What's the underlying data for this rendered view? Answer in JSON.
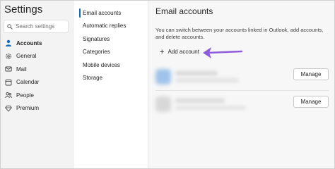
{
  "sidebar": {
    "title": "Settings",
    "search_placeholder": "Search settings",
    "items": [
      {
        "label": "Accounts",
        "icon": "person-icon",
        "active": true
      },
      {
        "label": "General",
        "icon": "gear-icon",
        "active": false
      },
      {
        "label": "Mail",
        "icon": "mail-icon",
        "active": false
      },
      {
        "label": "Calendar",
        "icon": "calendar-icon",
        "active": false
      },
      {
        "label": "People",
        "icon": "people-icon",
        "active": false
      },
      {
        "label": "Premium",
        "icon": "diamond-icon",
        "active": false
      }
    ]
  },
  "subnav": {
    "items": [
      {
        "label": "Email accounts",
        "active": true
      },
      {
        "label": "Automatic replies",
        "active": false
      },
      {
        "label": "Signatures",
        "active": false
      },
      {
        "label": "Categories",
        "active": false
      },
      {
        "label": "Mobile devices",
        "active": false
      },
      {
        "label": "Storage",
        "active": false
      }
    ]
  },
  "content": {
    "title": "Email accounts",
    "description": "You can switch between your accounts linked in Outlook, add accounts, and delete accounts.",
    "add_account_label": "Add account",
    "accounts": [
      {
        "manage_label": "Manage"
      },
      {
        "manage_label": "Manage"
      }
    ]
  },
  "colors": {
    "accent": "#0f6cbd",
    "annotation_arrow": "#8e5cdb"
  }
}
